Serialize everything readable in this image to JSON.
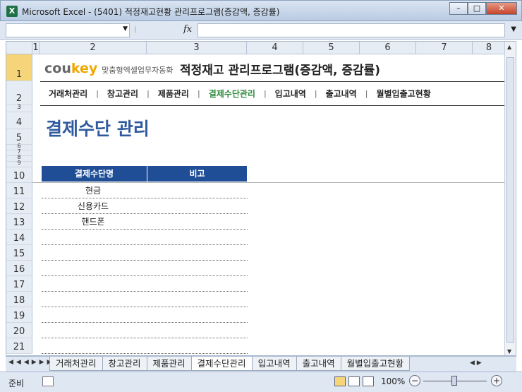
{
  "window": {
    "title": "Microsoft Excel - (5401) 적정재고현황 관리프로그램(증감액, 증감률)",
    "app_icon": "X",
    "minimize": "–",
    "maximize": "□",
    "close": "✕"
  },
  "formula_bar": {
    "name_box": "",
    "fx": "fx",
    "formula": ""
  },
  "columns": [
    "1",
    "2",
    "3",
    "4",
    "5",
    "6",
    "7",
    "8"
  ],
  "rows": [
    "1",
    "2",
    "3",
    "4",
    "5",
    "6",
    "7",
    "8",
    "9",
    "10",
    "11",
    "12",
    "13",
    "14",
    "15",
    "16",
    "17",
    "18",
    "19",
    "20",
    "21"
  ],
  "brand": {
    "co": "cou",
    "key": "key",
    "tagline": "맞춤형엑셀업무자동화"
  },
  "program_title": "적정재고 관리프로그램(증감액, 증감률)",
  "nav": {
    "items": [
      "거래처관리",
      "창고관리",
      "제품관리",
      "결제수단관리",
      "입고내역",
      "출고내역",
      "월별입출고현황"
    ],
    "active_index": 3,
    "separator": "|"
  },
  "section_title": "결제수단 관리",
  "table": {
    "headers": [
      "결제수단명",
      "비고"
    ],
    "rows": [
      [
        "현금",
        ""
      ],
      [
        "신용카드",
        ""
      ],
      [
        "핸드폰",
        ""
      ],
      [
        "",
        ""
      ],
      [
        "",
        ""
      ],
      [
        "",
        ""
      ],
      [
        "",
        ""
      ],
      [
        "",
        ""
      ],
      [
        "",
        ""
      ],
      [
        "",
        ""
      ],
      [
        "",
        ""
      ]
    ]
  },
  "sheet_tabs": {
    "items": [
      "거래처관리",
      "창고관리",
      "제품관리",
      "결제수단관리",
      "입고내역",
      "출고내역",
      "월별입출고현황"
    ],
    "active_index": 3
  },
  "status": {
    "ready": "준비",
    "zoom": "100%"
  }
}
